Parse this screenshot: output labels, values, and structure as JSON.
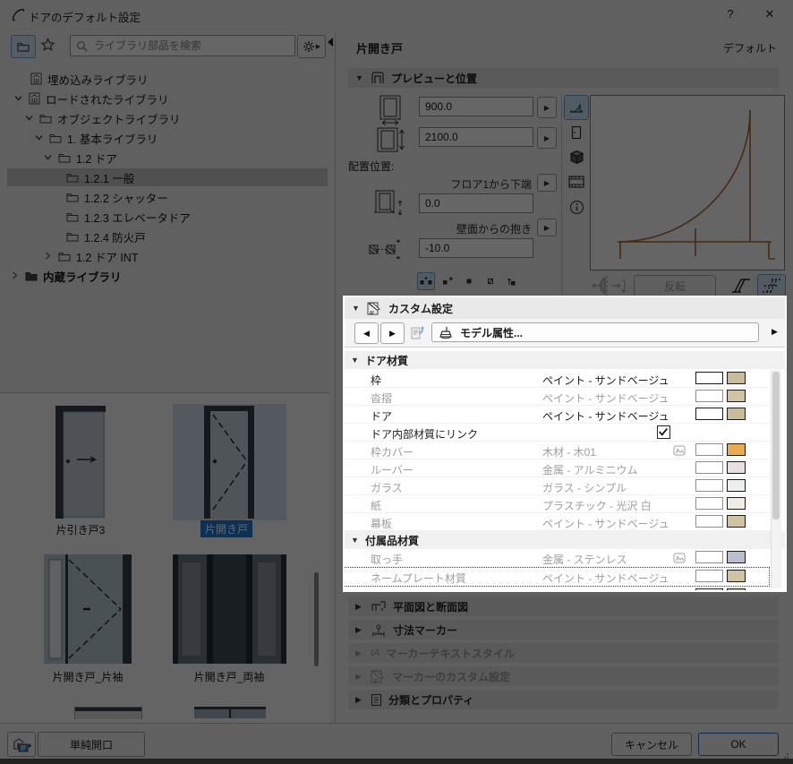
{
  "window": {
    "title": "ドアのデフォルト設定",
    "help": "?",
    "close": "✕"
  },
  "library_panel": {
    "search_placeholder": "ライブラリ部品を検索",
    "tree": [
      "埋め込みライブラリ",
      "ロードされたライブラリ",
      "オブジェクトライブラリ",
      "1. 基本ライブラリ",
      "1.2 ドア",
      "1.2.1 一般",
      "1.2.2 シャッター",
      "1.2.3 エレベータドア",
      "1.2.4 防火戸",
      "1.2 ドア INT",
      "内蔵ライブラリ"
    ],
    "thumbnails": [
      {
        "label": "片引き戸3"
      },
      {
        "label": "片開き戸"
      },
      {
        "label": "片開き戸_片袖"
      },
      {
        "label": "片開き戸_両袖"
      }
    ],
    "simple_opening_button": "単純開口"
  },
  "door_panel": {
    "name": "片開き戸",
    "preset": "デフォルト",
    "preview_section_title": "プレビューと位置",
    "width_value": "900.0",
    "height_value": "2100.0",
    "placement_label": "配置位置:",
    "floor_anchor_label": "フロア1から下端",
    "floor_anchor_value": "0.0",
    "reveal_label": "壁面からの抱き",
    "reveal_value": "-10.0",
    "flip_button": "反転",
    "custom_settings": {
      "title": "カスタム設定",
      "model_attributes_button": "モデル属性...",
      "groups": [
        {
          "title": "ドア材質",
          "rows": [
            {
              "name": "枠",
              "value": "ペイント - サンドベージュ",
              "swatch": "#c9bc9b",
              "disabled": false
            },
            {
              "name": "沓摺",
              "value": "ペイント - サンドベージュ",
              "swatch": "#cfc3a3",
              "disabled": true
            },
            {
              "name": "ドア",
              "value": "ペイント - サンドベージュ",
              "swatch": "#c9bc9b",
              "disabled": false
            },
            {
              "name": "ドア内部材質にリンク",
              "checkbox": true,
              "checked": true
            },
            {
              "name": "枠カバー",
              "value": "木材 - 木01",
              "swatch": "#e9aa51",
              "texture": true,
              "disabled": true
            },
            {
              "name": "ルーバー",
              "value": "金属 - アルミニウム",
              "swatch": "#e8dfdf",
              "disabled": true
            },
            {
              "name": "ガラス",
              "value": "ガラス - シンプル",
              "swatch": "#eaf1ed",
              "disabled": true
            },
            {
              "name": "紙",
              "value": "プラスチック - 光沢 白",
              "swatch": "#f0ede5",
              "disabled": true
            },
            {
              "name": "幕板",
              "value": "ペイント - サンドベージュ",
              "swatch": "#cfc3a3",
              "disabled": true
            }
          ]
        },
        {
          "title": "付属品材質",
          "rows": [
            {
              "name": "取っ手",
              "value": "金属 - ステンレス",
              "swatch": "#babfd0",
              "texture": true,
              "disabled": true
            },
            {
              "name": "ネームプレート材質",
              "value": "ペイント - サンドベージュ",
              "swatch": "#cfc3a3",
              "disabled": true,
              "focused": true
            }
          ]
        }
      ]
    },
    "collapsed_sections": [
      {
        "label": "平面図と断面図",
        "disabled": false
      },
      {
        "label": "寸法マーカー",
        "disabled": false
      },
      {
        "label": "マーカーテキストスタイル",
        "disabled": true
      },
      {
        "label": "マーカーのカスタム設定",
        "disabled": true
      },
      {
        "label": "分類とプロパティ",
        "disabled": false
      }
    ]
  },
  "footer": {
    "cancel": "キャンセル",
    "ok": "OK"
  }
}
